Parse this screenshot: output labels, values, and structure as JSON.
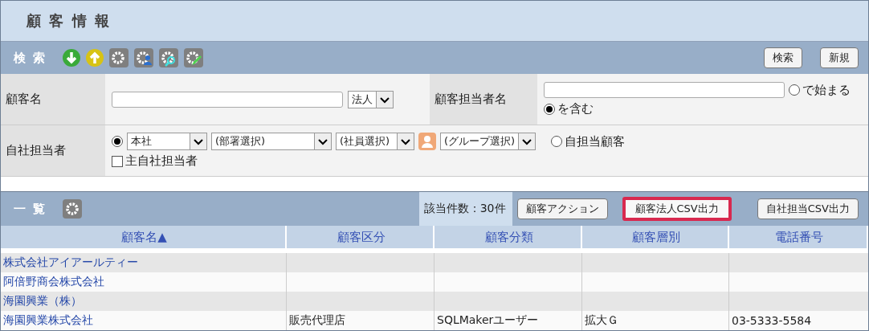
{
  "page_title": "顧 客 情 報",
  "search": {
    "title": "検 索",
    "tools": [
      {
        "kind": "download"
      },
      {
        "kind": "upload"
      },
      {
        "kind": "gear"
      },
      {
        "kind": "gear-person"
      },
      {
        "kind": "gear-search"
      },
      {
        "kind": "gear-pencil"
      }
    ],
    "buttons": [
      "検索",
      "新規"
    ],
    "customer_name": {
      "label": "顧客名",
      "type_select": "法人"
    },
    "contact_name": {
      "label": "顧客担当者名",
      "match": [
        {
          "label": "で始まる",
          "selected": false
        },
        {
          "label": "を含む",
          "selected": true
        }
      ]
    },
    "own_staff": {
      "label": "自社担当者",
      "scope": [
        {
          "kind": "selects",
          "selected": true,
          "selects": [
            "本社",
            "(部署選択)",
            "(社員選択)"
          ],
          "group_select": "(グループ選択)"
        },
        {
          "kind": "label",
          "label": "自担当顧客",
          "selected": false
        }
      ],
      "main_only": {
        "label": "主自社担当者",
        "checked": false
      }
    }
  },
  "list": {
    "title": "一 覧",
    "count": "該当件数：30件",
    "buttons": [
      {
        "label": "顧客アクション",
        "highlighted": false
      },
      {
        "label": "顧客法人CSV出力",
        "highlighted": true
      },
      {
        "label": "自社担当CSV出力",
        "highlighted": false
      }
    ],
    "columns": [
      "顧客名▲",
      "顧客区分",
      "顧客分類",
      "顧客層別",
      "電話番号"
    ],
    "rows": [
      {
        "cells": [
          "株式会社アイアールティー",
          "",
          "",
          "",
          ""
        ]
      },
      {
        "cells": [
          "阿倍野商会株式会社",
          "",
          "",
          "",
          ""
        ]
      },
      {
        "cells": [
          "海園興業（株）",
          "",
          "",
          "",
          ""
        ]
      },
      {
        "cells": [
          "海園興業株式会社",
          "販売代理店",
          "SQLMakerユーザー",
          "拡大Ｇ",
          "03-5333-5584"
        ]
      }
    ]
  }
}
